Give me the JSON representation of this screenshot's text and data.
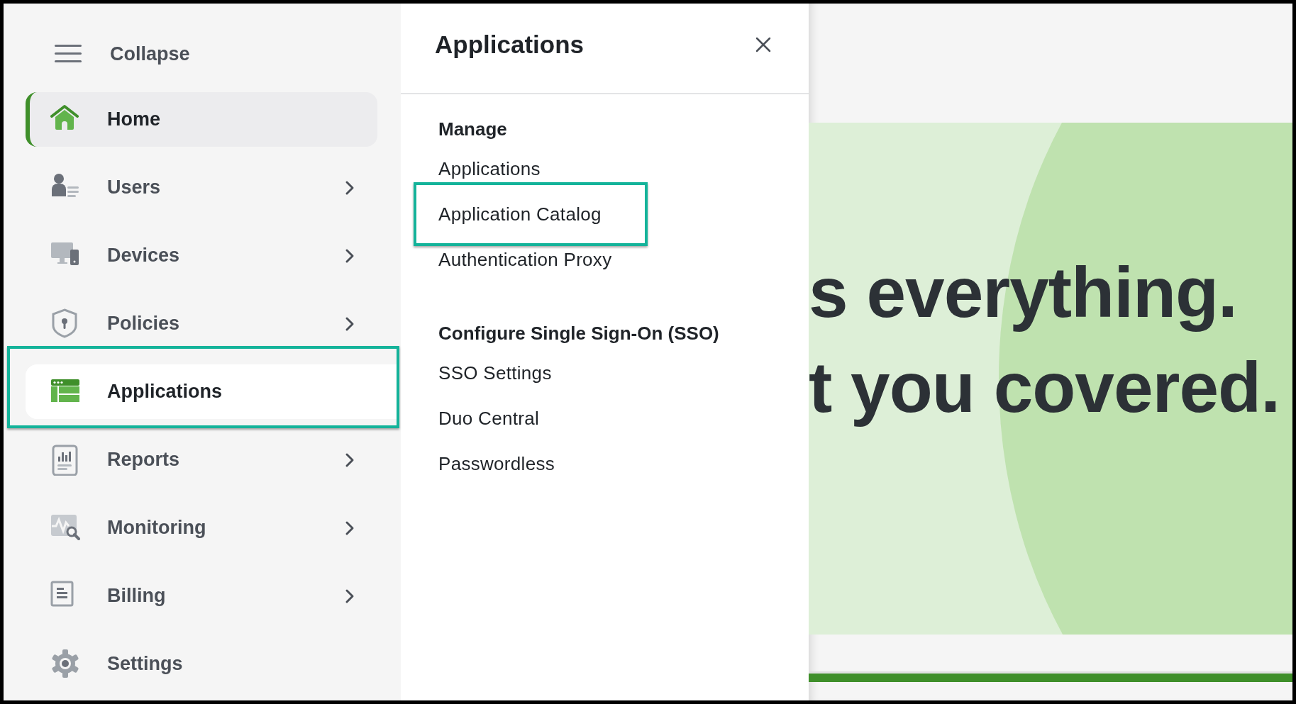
{
  "sidebar": {
    "collapse_label": "Collapse",
    "items": [
      {
        "label": "Home",
        "current": true,
        "open": false,
        "has_submenu": false,
        "highlighted": false
      },
      {
        "label": "Users",
        "current": false,
        "open": false,
        "has_submenu": true,
        "highlighted": false
      },
      {
        "label": "Devices",
        "current": false,
        "open": false,
        "has_submenu": true,
        "highlighted": false
      },
      {
        "label": "Policies",
        "current": false,
        "open": false,
        "has_submenu": true,
        "highlighted": false
      },
      {
        "label": "Applications",
        "current": false,
        "open": true,
        "has_submenu": false,
        "highlighted": true
      },
      {
        "label": "Reports",
        "current": false,
        "open": false,
        "has_submenu": true,
        "highlighted": false
      },
      {
        "label": "Monitoring",
        "current": false,
        "open": false,
        "has_submenu": true,
        "highlighted": false
      },
      {
        "label": "Billing",
        "current": false,
        "open": false,
        "has_submenu": true,
        "highlighted": false
      },
      {
        "label": "Settings",
        "current": false,
        "open": false,
        "has_submenu": false,
        "highlighted": false
      }
    ]
  },
  "flyout": {
    "title": "Applications",
    "sections": [
      {
        "heading": "Manage",
        "items": [
          {
            "label": "Applications",
            "highlighted": false
          },
          {
            "label": "Application Catalog",
            "highlighted": true
          },
          {
            "label": "Authentication Proxy",
            "highlighted": false
          }
        ]
      },
      {
        "heading": "Configure Single Sign-On (SSO)",
        "items": [
          {
            "label": "SSO Settings",
            "highlighted": false
          },
          {
            "label": "Duo Central",
            "highlighted": false
          },
          {
            "label": "Passwordless",
            "highlighted": false
          }
        ]
      }
    ]
  },
  "banner": {
    "lines": [
      "s everything.",
      "t you covered."
    ]
  }
}
